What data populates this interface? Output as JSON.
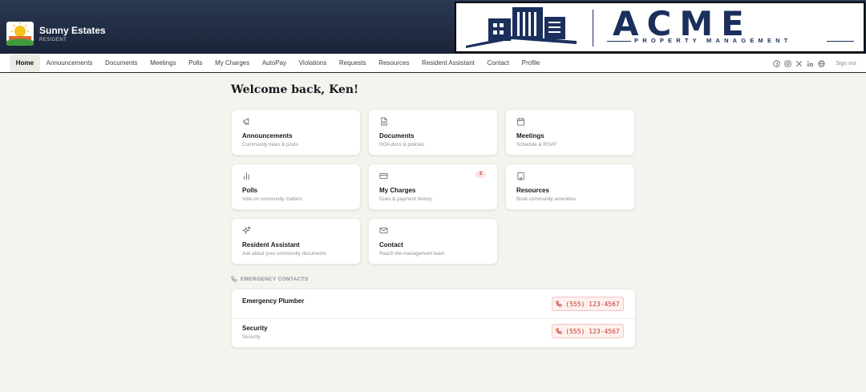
{
  "brand": {
    "name": "Sunny Estates",
    "role": "RESIDENT"
  },
  "banner": {
    "name": "ACME",
    "tagline": "PROPERTY MANAGEMENT"
  },
  "nav": {
    "items": [
      "Home",
      "Announcements",
      "Documents",
      "Meetings",
      "Polls",
      "My Charges",
      "AutoPay",
      "Violations",
      "Requests",
      "Resources",
      "Resident Assistant",
      "Contact",
      "Profile"
    ],
    "active": "Home",
    "social_icons": [
      "facebook-icon",
      "instagram-icon",
      "x-icon",
      "linkedin-icon",
      "globe-icon"
    ],
    "signout": "Sign out"
  },
  "welcome": "Welcome back, Ken!",
  "cards": [
    {
      "icon": "megaphone-icon",
      "title": "Announcements",
      "subtitle": "Community news & posts"
    },
    {
      "icon": "document-icon",
      "title": "Documents",
      "subtitle": "HOA docs & policies"
    },
    {
      "icon": "calendar-icon",
      "title": "Meetings",
      "subtitle": "Schedule & RSVP"
    },
    {
      "icon": "bar-chart-icon",
      "title": "Polls",
      "subtitle": "Vote on community matters"
    },
    {
      "icon": "credit-card-icon",
      "title": "My Charges",
      "subtitle": "Dues & payment history",
      "badge": "2"
    },
    {
      "icon": "building-icon",
      "title": "Resources",
      "subtitle": "Book community amenities"
    },
    {
      "icon": "sparkle-icon",
      "title": "Resident Assistant",
      "subtitle": "Ask about your community documents"
    },
    {
      "icon": "mail-icon",
      "title": "Contact",
      "subtitle": "Reach the management team"
    }
  ],
  "emergency": {
    "heading": "EMERGENCY CONTACTS",
    "contacts": [
      {
        "name": "Emergency Plumber",
        "subtitle": "",
        "phone": "(555) 123-4567"
      },
      {
        "name": "Security",
        "subtitle": "Security",
        "phone": "(555) 123-4567"
      }
    ]
  },
  "colors": {
    "header": "#1f2a40",
    "accent_red": "#c0392b",
    "background": "#f4f3ee",
    "acme_blue": "#1b2f5c"
  }
}
